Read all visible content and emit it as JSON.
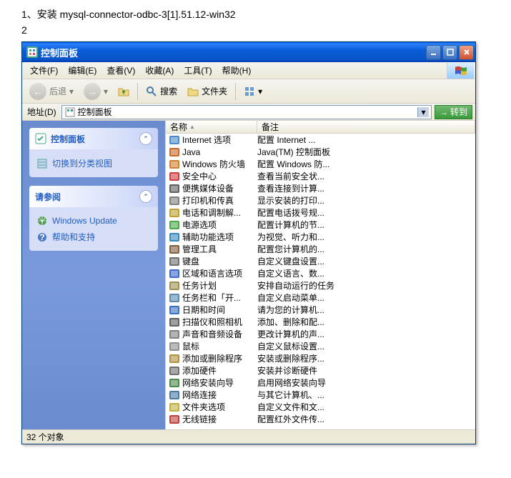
{
  "document": {
    "line1": "1、安装 mysql-connector-odbc-3[1].51.12-win32",
    "line2": "2"
  },
  "window": {
    "title": "控制面板",
    "menu": {
      "file": "文件(F)",
      "edit": "编辑(E)",
      "view": "查看(V)",
      "favorites": "收藏(A)",
      "tools": "工具(T)",
      "help": "帮助(H)"
    },
    "toolbar": {
      "back": "后退",
      "search": "搜索",
      "folders": "文件夹"
    },
    "address": {
      "label": "地址(D)",
      "value": "控制面板",
      "go": "转到"
    },
    "sidebar": {
      "panel1": {
        "title": "控制面板",
        "link1": "切换到分类视图"
      },
      "panel2": {
        "title": "请参阅",
        "link1": "Windows Update",
        "link2": "帮助和支持"
      }
    },
    "columns": {
      "name": "名称",
      "comment": "备注",
      "sort": "▲"
    },
    "items": [
      {
        "icon": "#4a8acc",
        "name": "Internet 选项",
        "comment": "配置 Internet ..."
      },
      {
        "icon": "#cc6a2a",
        "name": "Java",
        "comment": "Java(TM) 控制面板"
      },
      {
        "icon": "#d08030",
        "name": "Windows 防火墙",
        "comment": "配置 Windows 防..."
      },
      {
        "icon": "#d04040",
        "name": "安全中心",
        "comment": "查看当前安全状..."
      },
      {
        "icon": "#606060",
        "name": "便携媒体设备",
        "comment": "查看连接到计算..."
      },
      {
        "icon": "#808080",
        "name": "打印机和传真",
        "comment": "显示安装的打印..."
      },
      {
        "icon": "#c0a030",
        "name": "电话和调制解...",
        "comment": "配置电话拨号规..."
      },
      {
        "icon": "#4aaa4a",
        "name": "电源选项",
        "comment": "配置计算机的节..."
      },
      {
        "icon": "#3a8ac0",
        "name": "辅助功能选项",
        "comment": "为视觉、听力和..."
      },
      {
        "icon": "#806040",
        "name": "管理工具",
        "comment": "配置您计算机的..."
      },
      {
        "icon": "#707070",
        "name": "键盘",
        "comment": "自定义键盘设置..."
      },
      {
        "icon": "#3a6acc",
        "name": "区域和语言选项",
        "comment": "自定义语言、数..."
      },
      {
        "icon": "#a09050",
        "name": "任务计划",
        "comment": "安排自动运行的任务"
      },
      {
        "icon": "#5a8ab0",
        "name": "任务栏和「开...",
        "comment": "自定义启动菜单..."
      },
      {
        "icon": "#3a70c0",
        "name": "日期和时间",
        "comment": "请为您的计算机..."
      },
      {
        "icon": "#606060",
        "name": "扫描仪和照相机",
        "comment": "添加、删除和配..."
      },
      {
        "icon": "#808080",
        "name": "声音和音频设备",
        "comment": "更改计算机的声..."
      },
      {
        "icon": "#909090",
        "name": "鼠标",
        "comment": "自定义鼠标设置..."
      },
      {
        "icon": "#b09040",
        "name": "添加或删除程序",
        "comment": "安装或删除程序..."
      },
      {
        "icon": "#707070",
        "name": "添加硬件",
        "comment": "安装并诊断硬件"
      },
      {
        "icon": "#4a8a4a",
        "name": "网络安装向导",
        "comment": "启用网络安装向导"
      },
      {
        "icon": "#4a7aaa",
        "name": "网络连接",
        "comment": "与其它计算机、..."
      },
      {
        "icon": "#c0b040",
        "name": "文件夹选项",
        "comment": "自定义文件和文..."
      },
      {
        "icon": "#c04040",
        "name": "无线链接",
        "comment": "配置红外文件传..."
      }
    ],
    "status": "32 个对象"
  }
}
